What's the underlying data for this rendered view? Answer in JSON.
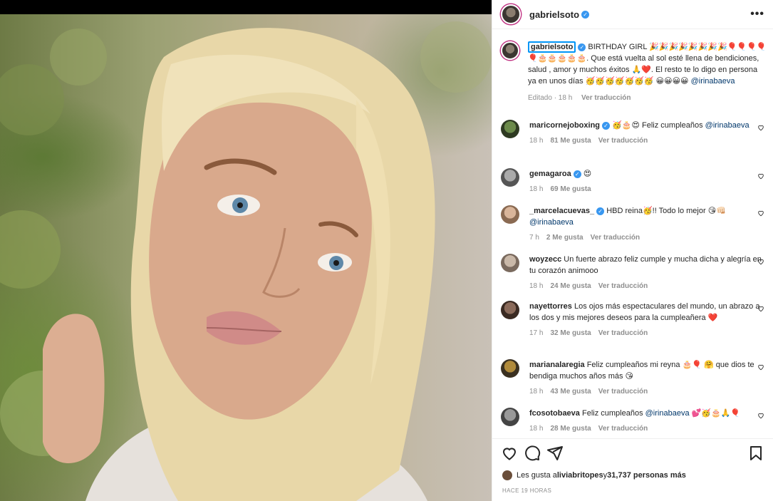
{
  "post": {
    "owner": "gabrielsoto",
    "more_label": "•••",
    "caption": {
      "username": "gabrielsoto",
      "text_1": " BIRTHDAY GIRL 🎉🎉🎉🎉🎉🎉🎉🎉🎈🎈🎈🎈🎈🎂🎂🎂🎂🎂. Que está vuelta al sol esté llena de bendiciones, salud , amor y muchos éxitos 🙏❤️. El resto te lo digo en persona ya en unos días 🥳🥳🥳🥳🥳🥳🥳 😀😀😀😀 ",
      "mention": "@irinabaeva",
      "time": "Editado · 18 h",
      "translate": "Ver traducción"
    }
  },
  "comments": [
    {
      "user": "maricornejoboxing",
      "verified": true,
      "text": " 🥳🎂😍 Feliz cumpleaños ",
      "mention": "@irinabaeva",
      "time": "18 h",
      "likes": "81 Me gusta",
      "translate": "Ver traducción"
    },
    {
      "user": "gemagaroa",
      "verified": true,
      "text": " 😍",
      "mention": "",
      "time": "18 h",
      "likes": "69 Me gusta",
      "translate": ""
    },
    {
      "user": "_marcelacuevas_",
      "verified": true,
      "text": " HBD reina🥳!! Todo lo mejor 😘👊🏻 ",
      "mention": "@irinabaeva",
      "time": "7 h",
      "likes": "2 Me gusta",
      "translate": "Ver traducción"
    },
    {
      "user": "woyzecc",
      "verified": false,
      "text": " Un fuerte abrazo feliz cumple y mucha dicha y alegría en tu corazón animooo",
      "mention": "",
      "time": "18 h",
      "likes": "24 Me gusta",
      "translate": "Ver traducción"
    },
    {
      "user": "nayettorres",
      "verified": false,
      "text": " Los ojos más espectaculares del mundo, un abrazo a los dos y mis mejores deseos para la cumpleañera ❤️",
      "mention": "",
      "time": "17 h",
      "likes": "32 Me gusta",
      "translate": "Ver traducción"
    },
    {
      "user": "marianalaregia",
      "verified": false,
      "text": " Feliz cumpleaños mi reyna 🎂🎈 🤗 que dios te bendiga muchos años más 😘",
      "mention": "",
      "time": "18 h",
      "likes": "43 Me gusta",
      "translate": "Ver traducción"
    },
    {
      "user": "fcosotobaeva",
      "verified": false,
      "text": " Feliz cumpleaños ",
      "mention": "@irinabaeva",
      "text_after": " 💕🥳🎂🙏🎈",
      "time": "18 h",
      "likes": "28 Me gusta",
      "translate": "Ver traducción"
    }
  ],
  "likes_line": {
    "prefix": "Les gusta a ",
    "user": "liviabritopes",
    "middle": " y ",
    "others": "31,737 personas más"
  },
  "timestamp": "HACE 19 HORAS",
  "colors": {
    "link": "#00376b",
    "meta": "#8e8e8e",
    "verified": "#3897f0"
  }
}
